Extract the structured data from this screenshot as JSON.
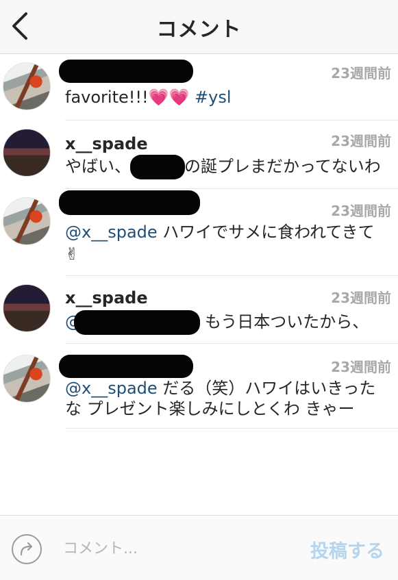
{
  "header": {
    "title": "コメント",
    "back_icon": "chevron-left-icon"
  },
  "comments": [
    {
      "username": "",
      "time": "23週間前",
      "text_main": "favorite!!!💗💗 ",
      "hashtag": "#ysl"
    },
    {
      "username": "x__spade",
      "time": "23週間前",
      "text_before": "やばい、",
      "text_after": "の誕プレまだかってないわ"
    },
    {
      "username": "",
      "time": "23週間前",
      "mention": "@x__spade",
      "text_line1": " ハワイでサメに食われてきて",
      "text_line2": "✌"
    },
    {
      "username": "x__spade",
      "time": "23週間前",
      "mention_prefix": "@",
      "text_after": "もう日本ついたから、"
    },
    {
      "username": "",
      "time": "23週間前",
      "mention": "@x__spade",
      "text_line1": " だる（笑）ハワイはいきった",
      "text_line2": "な プレゼント楽しみにしとくわ きゃー"
    }
  ],
  "footer": {
    "share_icon": "share-arrow-icon",
    "placeholder": "コメント...",
    "post_label": "投稿する"
  },
  "colors": {
    "link": "#1f4e79",
    "time": "#a8a8a8",
    "post_disabled": "#b5d5ee",
    "header_bg": "#f7f7f7"
  }
}
